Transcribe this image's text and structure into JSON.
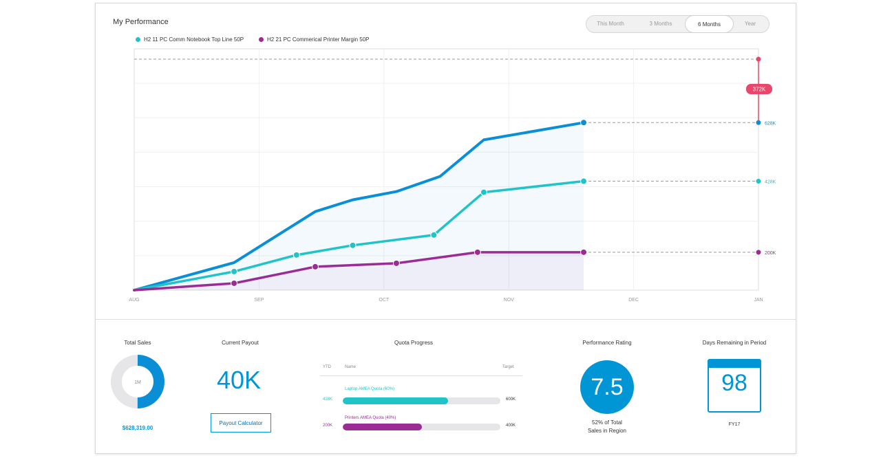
{
  "title": "My Performance",
  "periods": [
    {
      "label": "This Month",
      "active": false
    },
    {
      "label": "3 Months",
      "active": false
    },
    {
      "label": "6 Months",
      "active": true
    },
    {
      "label": "Year",
      "active": false
    }
  ],
  "legend": [
    {
      "label": "H2 11 PC Comm Notebook Top Line 50P",
      "color": "#20c4c8"
    },
    {
      "label": "H2 21 PC Commerical Printer Margin 50P",
      "color": "#9b2c95"
    }
  ],
  "chart_data": {
    "type": "line",
    "x_labels": [
      "AUG",
      "SEP",
      "OCT",
      "NOV",
      "DEC",
      "JAN"
    ],
    "ylim": [
      0,
      700
    ],
    "series": [
      {
        "color": "#0a8fd6",
        "x": [
          0,
          0.8,
          1.45,
          1.75,
          2.1,
          2.45,
          2.8,
          3.6
        ],
        "y": [
          0,
          80,
          228,
          262,
          286,
          330,
          436,
          486
        ],
        "area": true,
        "marker_indices": [
          7
        ]
      },
      {
        "name": "H2 11 PC Comm Notebook Top Line 50P",
        "color": "#20c4c8",
        "x": [
          0,
          0.8,
          1.3,
          1.75,
          2.4,
          2.8,
          3.6
        ],
        "y": [
          0,
          54,
          102,
          130,
          160,
          284,
          316
        ],
        "marker_indices": [
          1,
          2,
          3,
          4,
          5,
          6
        ]
      },
      {
        "name": "H2 21 PC Commerical Printer Margin 50P",
        "color": "#9b2c95",
        "x": [
          0,
          0.8,
          1.45,
          2.1,
          2.75,
          3.6
        ],
        "y": [
          0,
          20,
          68,
          78,
          110,
          110
        ],
        "area": true,
        "marker_indices": [
          1,
          2,
          3,
          4,
          5
        ]
      }
    ],
    "projections": [
      {
        "label": "628K",
        "y": 486,
        "color": "#0a8fd6"
      },
      {
        "label": "428K",
        "y": 316,
        "color": "#20c4c8"
      },
      {
        "label": "200K",
        "y": 110,
        "color": "#9b2c95"
      }
    ],
    "target": {
      "y": 670,
      "badge": "372K",
      "color": "#e8466b"
    }
  },
  "stats": {
    "total_sales": {
      "label": "Total Sales",
      "center": "1M",
      "value": "$628,319.00",
      "fraction": 0.5
    },
    "current_payout": {
      "label": "Current Payout",
      "value": "40K",
      "button": "Payout Calculator"
    },
    "quota_progress": {
      "label": "Quota Progress",
      "headers": {
        "ytd": "YTD",
        "name": "Name",
        "target": "Target"
      },
      "rows": [
        {
          "name": "Laptop AMEA Quota (60%)",
          "ytd": "428K",
          "target": "600K",
          "progress": 0.67,
          "color": "#20c4c8"
        },
        {
          "name": "Printers AMEA Quota (40%)",
          "ytd": "200K",
          "target": "400K",
          "progress": 0.5,
          "color": "#9b2c95"
        }
      ]
    },
    "performance_rating": {
      "label": "Performance Rating",
      "value": "7.5",
      "line1": "52% of Total",
      "line2": "Sales in Region"
    },
    "days_remaining": {
      "label": "Days Remaining in Period",
      "value": "98",
      "caption": "FY17"
    }
  }
}
